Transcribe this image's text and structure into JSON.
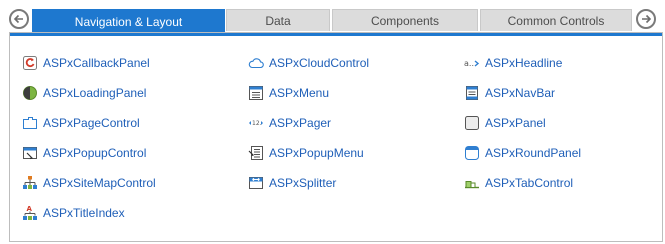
{
  "tabs": [
    {
      "label": "Navigation & Layout",
      "active": true
    },
    {
      "label": "Data",
      "active": false
    },
    {
      "label": "Components",
      "active": false
    },
    {
      "label": "Common Controls",
      "active": false
    }
  ],
  "columns": [
    [
      {
        "label": "ASPxCallbackPanel",
        "icon": "callback-panel-icon"
      },
      {
        "label": "ASPxLoadingPanel",
        "icon": "loading-panel-icon"
      },
      {
        "label": "ASPxPageControl",
        "icon": "page-control-icon"
      },
      {
        "label": "ASPxPopupControl",
        "icon": "popup-control-icon"
      },
      {
        "label": "ASPxSiteMapControl",
        "icon": "sitemap-icon"
      },
      {
        "label": "ASPxTitleIndex",
        "icon": "title-index-icon"
      }
    ],
    [
      {
        "label": "ASPxCloudControl",
        "icon": "cloud-icon"
      },
      {
        "label": "ASPxMenu",
        "icon": "menu-icon"
      },
      {
        "label": "ASPxPager",
        "icon": "pager-icon"
      },
      {
        "label": "ASPxPopupMenu",
        "icon": "popup-menu-icon"
      },
      {
        "label": "ASPxSplitter",
        "icon": "splitter-icon"
      }
    ],
    [
      {
        "label": "ASPxHeadline",
        "icon": "headline-icon"
      },
      {
        "label": "ASPxNavBar",
        "icon": "navbar-icon"
      },
      {
        "label": "ASPxPanel",
        "icon": "panel-icon"
      },
      {
        "label": "ASPxRoundPanel",
        "icon": "round-panel-icon"
      },
      {
        "label": "ASPxTabControl",
        "icon": "tab-control-icon"
      }
    ]
  ],
  "colors": {
    "accent": "#1e78cf",
    "link": "#1f5fb8",
    "tab_inactive": "#dcdcdc"
  }
}
